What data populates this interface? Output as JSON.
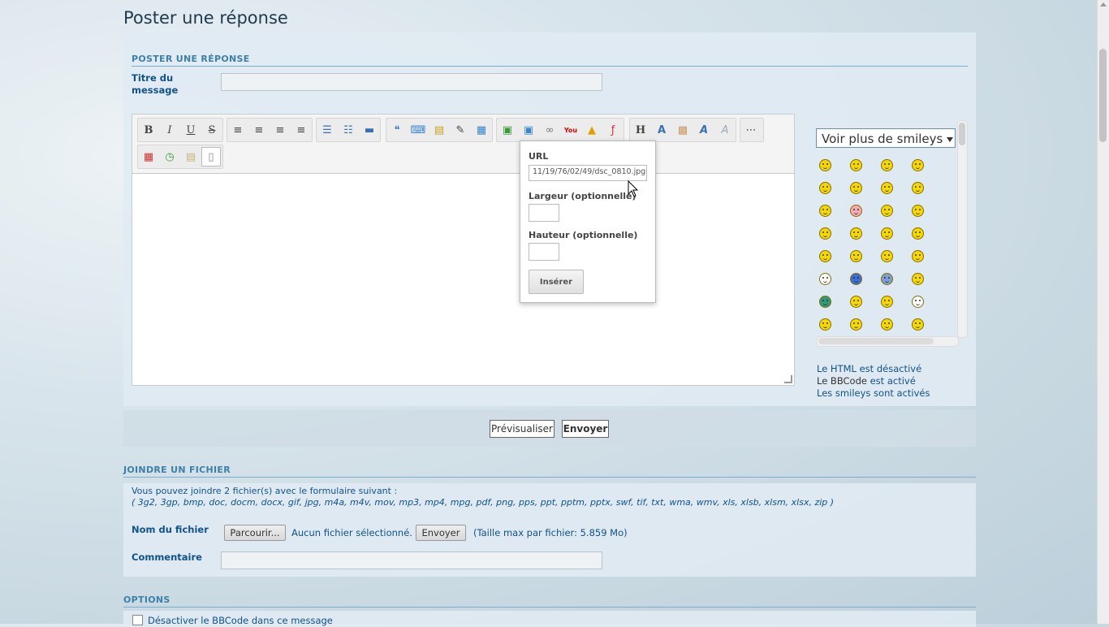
{
  "page": {
    "title": "Poster une réponse"
  },
  "post_section": {
    "heading": "POSTER UNE RÉPONSE",
    "subject_label": "Titre du message",
    "subject_value": ""
  },
  "toolbar": {
    "row1": [
      {
        "icon": "bold-icon",
        "glyph": "B"
      },
      {
        "icon": "italic-icon",
        "glyph": "I"
      },
      {
        "icon": "underline-icon",
        "glyph": "U"
      },
      {
        "icon": "strikethrough-icon",
        "glyph": "S"
      },
      {
        "icon": "align-left-icon",
        "glyph": "≡"
      },
      {
        "icon": "align-center-icon",
        "glyph": "≡"
      },
      {
        "icon": "align-right-icon",
        "glyph": "≡"
      },
      {
        "icon": "align-justify-icon",
        "glyph": "≡"
      },
      {
        "icon": "bullet-list-icon",
        "glyph": "☰"
      },
      {
        "icon": "numbered-list-icon",
        "glyph": "☷"
      },
      {
        "icon": "horizontal-rule-icon",
        "glyph": "▬"
      },
      {
        "icon": "quote-icon",
        "glyph": "❝"
      },
      {
        "icon": "code-icon",
        "glyph": "⌨"
      },
      {
        "icon": "spoiler-icon",
        "glyph": "⚠"
      },
      {
        "icon": "edit-icon",
        "glyph": "✎"
      },
      {
        "icon": "table-icon",
        "glyph": "▦"
      },
      {
        "icon": "image-icon",
        "glyph": "🖼"
      },
      {
        "icon": "upload-image-icon",
        "glyph": "⬆"
      },
      {
        "icon": "link-icon",
        "glyph": "∞"
      },
      {
        "icon": "youtube-icon",
        "glyph": "▶"
      },
      {
        "icon": "warning-icon",
        "glyph": "⚠"
      },
      {
        "icon": "flash-icon",
        "glyph": "ƒ"
      },
      {
        "icon": "heading-icon",
        "glyph": "H"
      },
      {
        "icon": "font-size-icon",
        "glyph": "A"
      },
      {
        "icon": "color-icon",
        "glyph": "▩"
      },
      {
        "icon": "font-icon",
        "glyph": "A"
      },
      {
        "icon": "clear-format-icon",
        "glyph": "A"
      },
      {
        "icon": "more-icon",
        "glyph": "⋯"
      }
    ],
    "row2": [
      {
        "icon": "calendar-icon",
        "glyph": "▦"
      },
      {
        "icon": "clock-icon",
        "glyph": "◷"
      },
      {
        "icon": "paste-icon",
        "glyph": "▤"
      },
      {
        "icon": "source-icon",
        "glyph": "▯"
      }
    ]
  },
  "image_popup": {
    "url_label": "URL",
    "url_value": "11/19/76/02/49/dsc_0810.jpg",
    "width_label": "Largeur (optionnelle)",
    "width_value": "",
    "height_label": "Hauteur (optionnelle)",
    "height_value": "",
    "insert_label": "Insérer"
  },
  "smileys": {
    "select_label": "Voir plus de smileys",
    "colors": [
      "#f5d800",
      "#f5d800",
      "#f5d800",
      "#f5d800",
      "#f5d800",
      "#f5d800",
      "#f5d800",
      "#f5d800",
      "#f5d800",
      "#f7a9b4",
      "#f5d800",
      "#f5d800",
      "#f5d800",
      "#f5d800",
      "#f5d800",
      "#f5d800",
      "#f5d800",
      "#f5d800",
      "#f5d800",
      "#f5d800",
      "#ffffff",
      "#3a6fd8",
      "#7c9fd6",
      "#f5d800",
      "#2e9a7a",
      "#f5d800",
      "#f5d800",
      "#ffffff",
      "#f5d800",
      "#f5d800",
      "#f5d800",
      "#f5d800"
    ]
  },
  "status": {
    "html_off": "Le HTML est désactivé",
    "bbcode_prefix": "Le BBCode",
    "bbcode_suffix": "est activé",
    "smileys_on": "Les smileys sont activés"
  },
  "buttons": {
    "preview": "Prévisualiser",
    "submit": "Envoyer"
  },
  "attach_section": {
    "heading": "JOINDRE UN FICHIER",
    "info": "Vous pouvez joindre 2 fichier(s) avec le formulaire suivant :",
    "extensions": "( 3g2, 3gp, bmp, doc, docm, docx, gif, jpg, m4a, m4v, mov, mp3, mp4, mpg, pdf, png, pps, ppt, pptm, pptx, swf, tif, txt, wma, wmv, xls, xlsb, xlsm, xlsx, zip )",
    "file_label": "Nom du fichier",
    "browse_label": "Parcourir...",
    "no_file": "Aucun fichier sélectionné.",
    "send_label": "Envoyer",
    "max_size": "(Taille max par fichier: 5.859 Mo)",
    "comment_label": "Commentaire",
    "comment_value": ""
  },
  "options_section": {
    "heading": "OPTIONS",
    "disable_bbcode": "Désactiver le BBCode dans ce message"
  }
}
